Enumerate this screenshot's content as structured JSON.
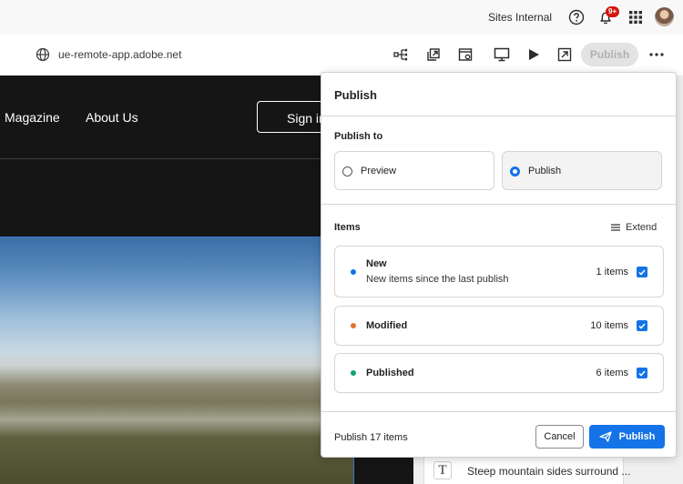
{
  "topbar": {
    "org_name": "Sites Internal",
    "notification_badge": "9+",
    "icons": [
      "help-icon",
      "bell-icon",
      "apps-grid-icon"
    ]
  },
  "toolbar": {
    "url": "ue-remote-app.adobe.net",
    "publish_label": "Publish",
    "icons": [
      "content-tree-icon",
      "open-in-new-icon",
      "page-settings-icon",
      "desktop-icon",
      "play-icon",
      "open-app-icon",
      "more-icon"
    ]
  },
  "page": {
    "nav_items": [
      "Magazine",
      "About Us"
    ],
    "sign_in": "Sign in",
    "text_component": "Steep mountain sides surround ..."
  },
  "dialog": {
    "title": "Publish",
    "publish_to_label": "Publish to",
    "targets": [
      {
        "label": "Preview",
        "selected": false
      },
      {
        "label": "Publish",
        "selected": true
      }
    ],
    "items_label": "Items",
    "extend_label": "Extend",
    "items": [
      {
        "name": "New",
        "description": "New items since the last publish",
        "count": "1 items",
        "color": "#1473e6",
        "checked": true
      },
      {
        "name": "Modified",
        "description": "",
        "count": "10 items",
        "color": "#e0732a",
        "checked": true
      },
      {
        "name": "Published",
        "description": "",
        "count": "6 items",
        "color": "#12a26c",
        "checked": true
      }
    ],
    "footer_count": "Publish 17 items",
    "cancel_label": "Cancel",
    "publish_label": "Publish"
  },
  "colors": {
    "accent": "#1473e6",
    "badge": "#d31510",
    "page_dark": "#151515"
  }
}
